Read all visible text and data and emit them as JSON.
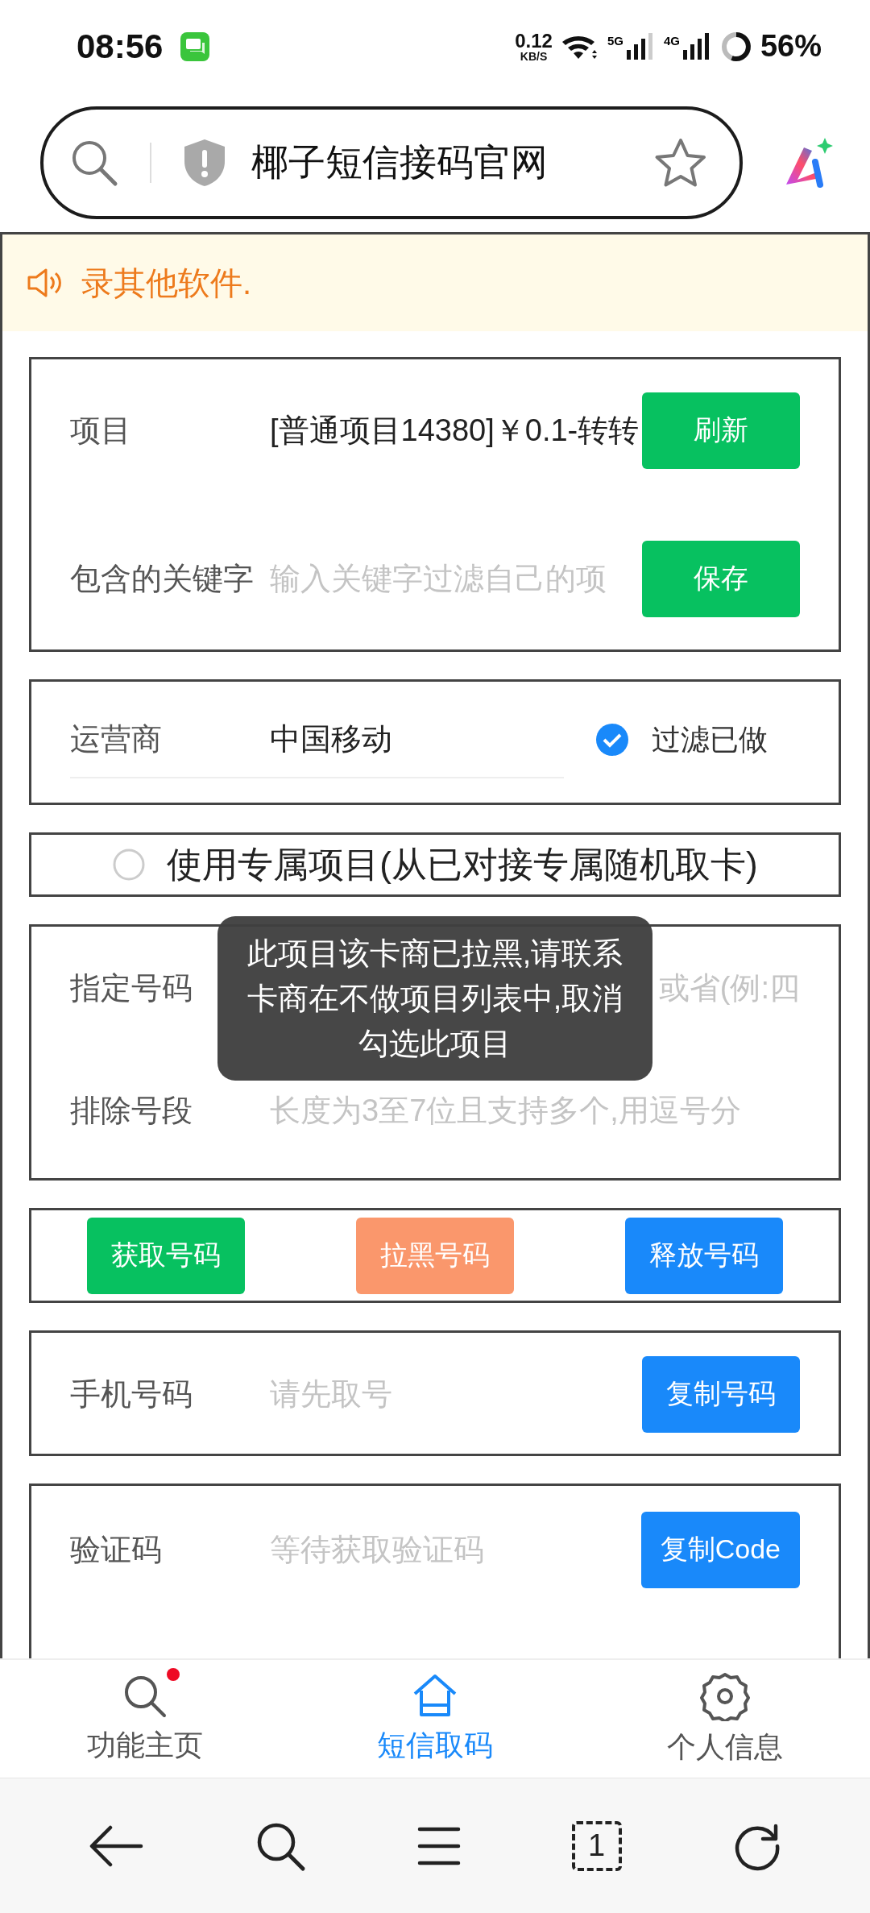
{
  "status_bar": {
    "time": "08:56",
    "net_speed": "0.12",
    "net_unit": "KB/S",
    "sim1": "5G",
    "sim2": "4G",
    "battery": "56%"
  },
  "address_bar": {
    "title": "椰子短信接码官网"
  },
  "notice": {
    "text": "录其他软件."
  },
  "sections": [
    {
      "rows": [
        {
          "kind": "value",
          "label": "项目",
          "value": "[普通项目14380]￥0.1-转转",
          "button": {
            "label": "刷新",
            "color": "#07c160"
          }
        },
        {
          "kind": "input",
          "label": "包含的关键字",
          "placeholder": "输入关键字过滤自己的项",
          "button": {
            "label": "保存",
            "color": "#07c160"
          }
        }
      ]
    },
    {
      "rows": [
        {
          "kind": "select",
          "label": "运营商",
          "value": "中国移动",
          "check": {
            "label": "过滤已做",
            "checked": true
          }
        }
      ]
    },
    {
      "rows": [
        {
          "kind": "radio",
          "label": "使用专属项目(从已对接专属随机取卡)",
          "selected": false
        }
      ]
    },
    {
      "rows": [
        {
          "kind": "input",
          "label": "指定号码",
          "placeholder": "或省(例:四"
        },
        {
          "kind": "input",
          "label": "排除号段",
          "placeholder": "长度为3至7位且支持多个,用逗号分"
        }
      ]
    },
    {
      "rows": [
        {
          "kind": "buttons",
          "buttons": [
            {
              "label": "获取号码",
              "color": "#07c160"
            },
            {
              "label": "拉黑号码",
              "color": "#fa976c"
            },
            {
              "label": "释放号码",
              "color": "#1989fa"
            }
          ]
        }
      ]
    },
    {
      "rows": [
        {
          "kind": "input",
          "label": "手机号码",
          "placeholder": "请先取号",
          "button": {
            "label": "复制号码",
            "color": "#1989fa"
          }
        }
      ]
    },
    {
      "rows": [
        {
          "kind": "input",
          "label": "验证码",
          "placeholder": "等待获取验证码",
          "button": {
            "label": "复制Code",
            "color": "#1989fa"
          }
        }
      ]
    }
  ],
  "toast": {
    "text": "此项目该卡商已拉黑,请联系卡商在不做项目列表中,取消勾选此项目"
  },
  "tabs": [
    {
      "label": "功能主页",
      "selected": false,
      "badge": true
    },
    {
      "label": "短信取码",
      "selected": true,
      "badge": false
    },
    {
      "label": "个人信息",
      "selected": false,
      "badge": false
    }
  ],
  "browser_nav": {
    "tab_count": "1"
  }
}
